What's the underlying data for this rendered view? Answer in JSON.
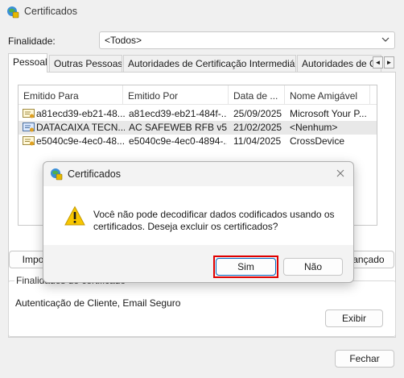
{
  "window": {
    "title": "Certificados"
  },
  "filter": {
    "label": "Finalidade:",
    "value": "<Todos>"
  },
  "tabs": [
    {
      "label": "Pessoal"
    },
    {
      "label": "Outras Pessoas"
    },
    {
      "label": "Autoridades de Certificação Intermediárias"
    },
    {
      "label": "Autoridades de Ce"
    }
  ],
  "tab_scroll": {
    "left": "◄",
    "right": "►"
  },
  "table": {
    "columns": [
      "Emitido Para",
      "Emitido Por",
      "Data de ...",
      "Nome Amigável"
    ],
    "rows": [
      {
        "issued_to": "a81ecd39-eb21-48...",
        "issued_by": "a81ecd39-eb21-484f-...",
        "date": "25/09/2025",
        "friendly": "Microsoft Your P..."
      },
      {
        "issued_to": "DATACAIXA TECN...",
        "issued_by": "AC SAFEWEB RFB v5",
        "date": "21/02/2025",
        "friendly": "<Nenhum>"
      },
      {
        "issued_to": "e5040c9e-4ec0-48...",
        "issued_by": "e5040c9e-4ec0-4894-...",
        "date": "11/04/2025",
        "friendly": "CrossDevice"
      }
    ]
  },
  "buttons": {
    "import": "Importar",
    "advanced": "Avançado",
    "view": "Exibir",
    "close": "Fechar"
  },
  "purposes": {
    "title": "Finalidades do certificado",
    "value": "Autenticação de Cliente, Email Seguro"
  },
  "dialog": {
    "title": "Certificados",
    "message": "Você não pode decodificar dados codificados usando os certificados. Deseja excluir os certificados?",
    "yes": "Sim",
    "no": "Não"
  },
  "colors": {
    "accent": "#0067c0",
    "highlight": "#e00000",
    "warning": "#f7c600"
  }
}
